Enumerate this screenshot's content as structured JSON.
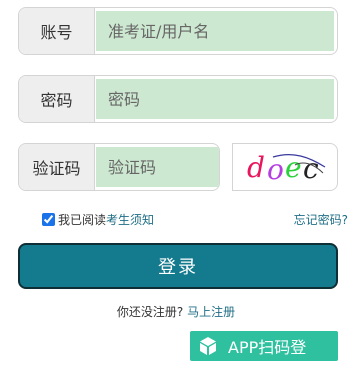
{
  "form": {
    "account": {
      "label": "账号",
      "placeholder": "准考证/用户名"
    },
    "password": {
      "label": "密码",
      "placeholder": "密码"
    },
    "captcha": {
      "label": "验证码",
      "placeholder": "验证码",
      "image_text": "doec"
    }
  },
  "agreement": {
    "prefix": "我已阅读",
    "link": "考生须知",
    "checked": true
  },
  "forgot_password": "忘记密码?",
  "login_button": "登录",
  "register": {
    "prompt": "你还没注册?",
    "link": "马上注册"
  },
  "app_scan": {
    "label": "APP扫码登",
    "icon": "cube-icon"
  },
  "colors": {
    "input_fill": "#cde8d1",
    "primary_button": "#147a8e",
    "link": "#1f6e87",
    "app_button": "#2fc0a0"
  }
}
